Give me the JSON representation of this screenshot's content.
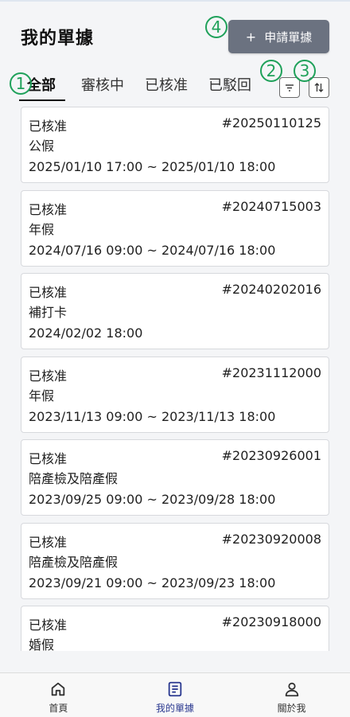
{
  "header": {
    "title": "我的單據",
    "apply_button": "申請單據",
    "apply_icon": "plus-icon"
  },
  "markers": [
    "1",
    "2",
    "3",
    "4"
  ],
  "tabs": [
    {
      "label": "全部",
      "active": true
    },
    {
      "label": "審核中",
      "active": false
    },
    {
      "label": "已核准",
      "active": false
    },
    {
      "label": "已駁回",
      "active": false
    }
  ],
  "toolbar": {
    "filter_icon": "filter-icon",
    "sort_icon": "sort-icon"
  },
  "records": [
    {
      "status": "已核准",
      "id": "#20250110125",
      "type": "公假",
      "period": "2025/01/10 17:00 ~ 2025/01/10 18:00"
    },
    {
      "status": "已核准",
      "id": "#20240715003",
      "type": "年假",
      "period": "2024/07/16 09:00 ~ 2024/07/16 18:00"
    },
    {
      "status": "已核准",
      "id": "#20240202016",
      "type": "補打卡",
      "period": "2024/02/02 18:00"
    },
    {
      "status": "已核准",
      "id": "#20231112000",
      "type": "年假",
      "period": "2023/11/13 09:00 ~ 2023/11/13 18:00"
    },
    {
      "status": "已核准",
      "id": "#20230926001",
      "type": "陪產檢及陪產假",
      "period": "2023/09/25 09:00 ~ 2023/09/28 18:00"
    },
    {
      "status": "已核准",
      "id": "#20230920008",
      "type": "陪產檢及陪產假",
      "period": "2023/09/21 09:00 ~ 2023/09/23 18:00"
    },
    {
      "status": "已核准",
      "id": "#20230918000",
      "type": "婚假",
      "period": ""
    }
  ],
  "nav": [
    {
      "label": "首頁",
      "icon": "home-icon",
      "active": false
    },
    {
      "label": "我的單據",
      "icon": "document-icon",
      "active": true
    },
    {
      "label": "關於我",
      "icon": "user-icon",
      "active": false
    }
  ],
  "colors": {
    "accent": "#2b3990",
    "button": "#6b7280",
    "marker": "#1fa15a"
  }
}
